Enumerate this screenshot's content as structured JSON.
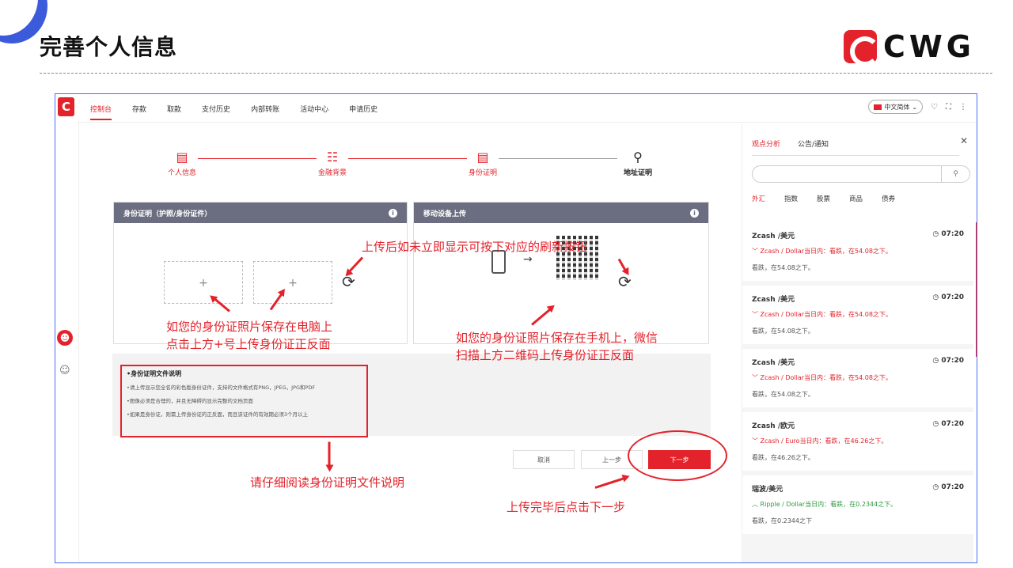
{
  "slide": {
    "title": "完善个人信息",
    "brand": "CWG"
  },
  "app": {
    "logo": "C",
    "nav": [
      "控制台",
      "存款",
      "取款",
      "支付历史",
      "内部转账",
      "活动中心",
      "申请历史"
    ],
    "language": "中文简体",
    "icons": [
      "bell-icon",
      "fullscreen-icon",
      "more-icon"
    ]
  },
  "steps": [
    {
      "label": "个人信息",
      "icon": "person-card-icon"
    },
    {
      "label": "金融背景",
      "icon": "book-icon"
    },
    {
      "label": "身份证明",
      "icon": "id-card-icon"
    },
    {
      "label": "地址证明",
      "icon": "map-pin-icon"
    }
  ],
  "id_panel": {
    "title": "身份证明（护照/身份证件）",
    "plus": "+"
  },
  "mobile_panel": {
    "title": "移动设备上传",
    "arrow": "→"
  },
  "notes": {
    "title": "•身份证明文件说明",
    "lines": [
      "•请上传显示您全名的彩色版身份证件，支持的文件格式有PNG，JPEG，JPG和PDF",
      "•图像必须是合理的，并且无障碍的显示完整的文档页面",
      "•如果是身份证，则需上传身份证的正反面，而且该证件的有效期必须3个月以上"
    ]
  },
  "buttons": {
    "cancel": "取消",
    "prev": "上一步",
    "next": "下一步"
  },
  "annotations": {
    "refresh_hint": "上传后如未立即显示可按下对应的刷新按钮",
    "pc_hint_1": "如您的身份证照片保存在电脑上",
    "pc_hint_2": "点击上方+号上传身份证正反面",
    "mobile_hint_1": "如您的身份证照片保存在手机上，微信",
    "mobile_hint_2": "扫描上方二维码上传身份证正反面",
    "notes_hint": "请仔细阅读身份证明文件说明",
    "next_hint": "上传完毕后点击下一步"
  },
  "right_panel": {
    "tabs": [
      "观点分析",
      "公告/通知"
    ],
    "categories": [
      "外汇",
      "指数",
      "股票",
      "商品",
      "债券"
    ],
    "items": [
      {
        "title": "Zcash /美元",
        "time": "07:20",
        "desc": "﹀ Zcash / Dollar当日内：看跌，在54.08之下。",
        "dir": "down",
        "summary": "看跌，在54.08之下。"
      },
      {
        "title": "Zcash /美元",
        "time": "07:20",
        "desc": "﹀ Zcash / Dollar当日内：看跌，在54.08之下。",
        "dir": "down",
        "summary": "看跌，在54.08之下。"
      },
      {
        "title": "Zcash /美元",
        "time": "07:20",
        "desc": "﹀ Zcash / Dollar当日内：看跌，在54.08之下。",
        "dir": "down",
        "summary": "看跌，在54.08之下。"
      },
      {
        "title": "Zcash /欧元",
        "time": "07:20",
        "desc": "﹀ Zcash / Euro当日内：看跌，在46.26之下。",
        "dir": "down",
        "summary": "看跌，在46.26之下。"
      },
      {
        "title": "瑞波/美元",
        "time": "07:20",
        "desc": "︿ Ripple / Dollar当日内：看跌，在0.2344之下。",
        "dir": "up",
        "summary": "看跌，在0.2344之下"
      }
    ]
  },
  "colors": {
    "accent": "#e3222b",
    "frame": "#4c6ef5",
    "panel_header": "#6b6e80"
  }
}
